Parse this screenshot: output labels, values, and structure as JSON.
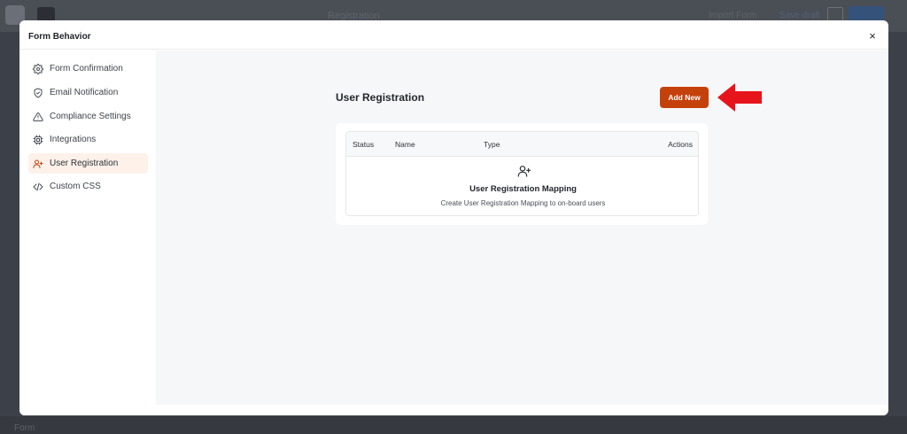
{
  "modal": {
    "title": "Form Behavior",
    "close_symbol": "×"
  },
  "background": {
    "page_title": "Registration",
    "right_link_1": "Import Form",
    "right_link_2": "Save draft",
    "footer_text": "Form"
  },
  "sidebar": {
    "items": [
      {
        "label": "Form Confirmation",
        "icon": "gear-icon"
      },
      {
        "label": "Email Notification",
        "icon": "shield-icon"
      },
      {
        "label": "Compliance Settings",
        "icon": "warning-icon"
      },
      {
        "label": "Integrations",
        "icon": "chip-icon"
      },
      {
        "label": "User Registration",
        "icon": "user-plus-icon",
        "active": true
      },
      {
        "label": "Custom CSS",
        "icon": "code-icon"
      }
    ]
  },
  "main": {
    "title": "User Registration",
    "add_button": "Add New",
    "table": {
      "columns": [
        "Status",
        "Name",
        "Type",
        "Actions"
      ],
      "empty_title": "User Registration Mapping",
      "empty_subtitle": "Create User Registration Mapping to on-board users"
    }
  },
  "colors": {
    "accent": "#c5410c",
    "active_bg": "#fdf1ea",
    "arrow": "#e8141b"
  }
}
